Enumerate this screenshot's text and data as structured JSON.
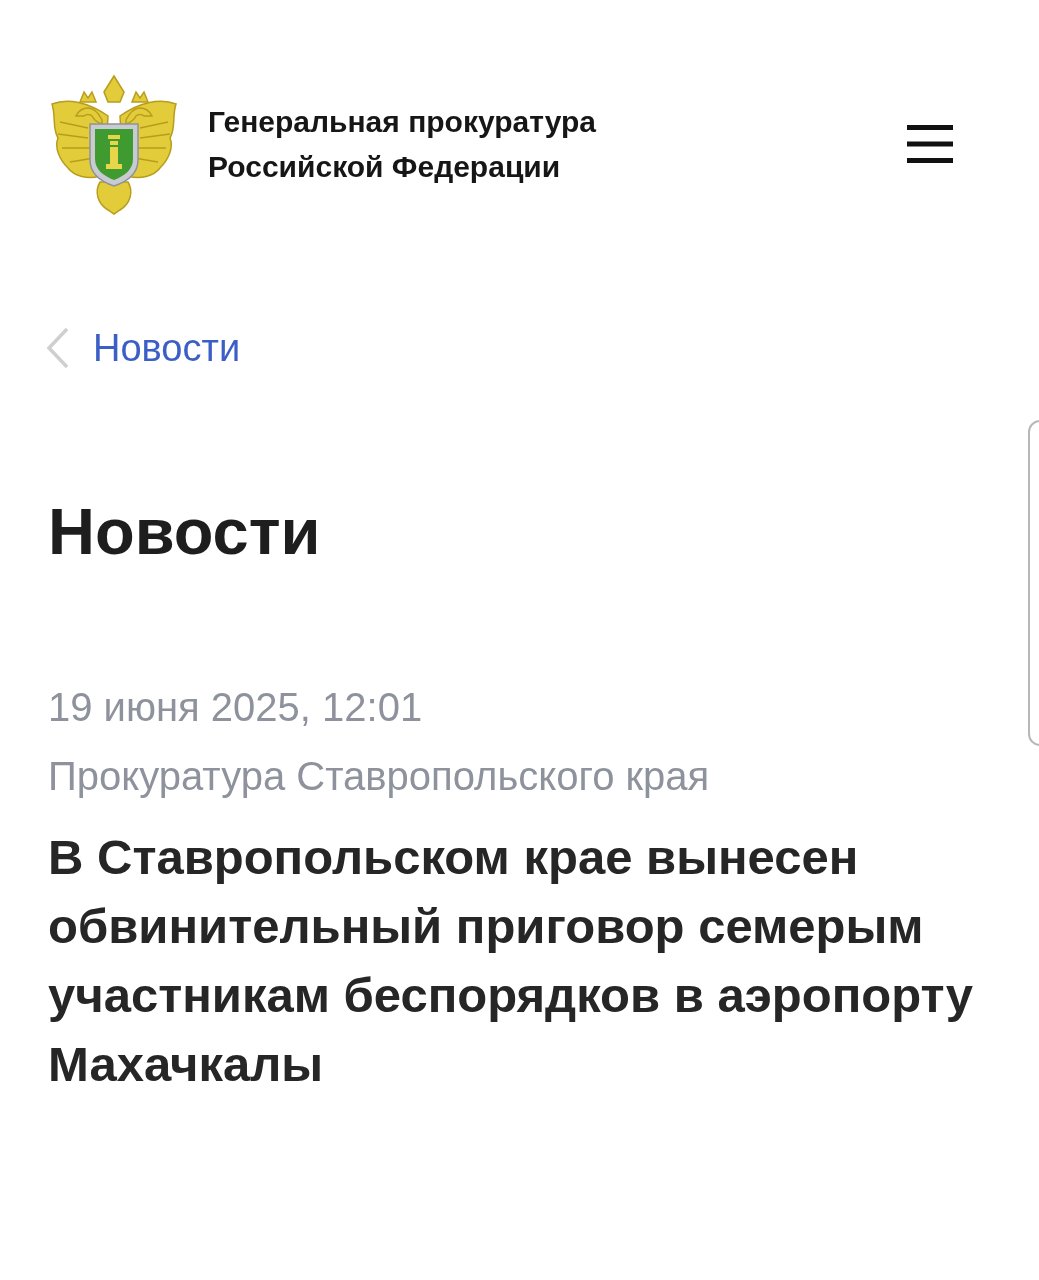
{
  "header": {
    "title": "Генеральная прокуратура Российской Федерации"
  },
  "breadcrumb": {
    "label": "Новости"
  },
  "page_title": "Новости",
  "article": {
    "date": "19 июня 2025, 12:01",
    "source": "Прокуратура Ставропольского края",
    "headline": "В Ставропольском крае вынесен обвинительный приговор семерым участникам беспорядков в аэропорту Махачкалы"
  }
}
